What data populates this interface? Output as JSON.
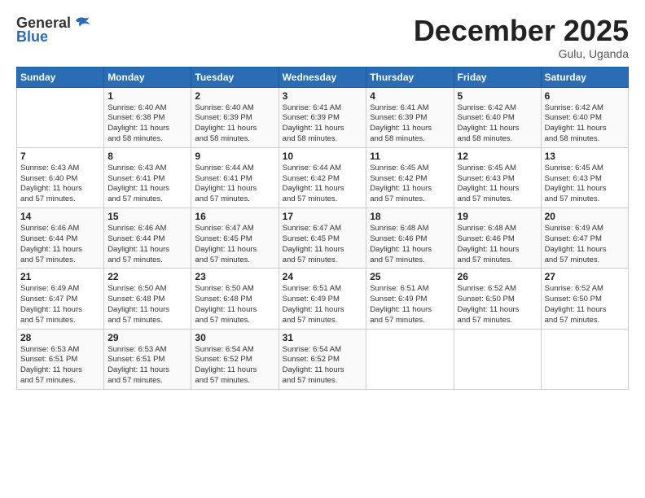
{
  "header": {
    "logo_general": "General",
    "logo_blue": "Blue",
    "title": "December 2025",
    "location": "Gulu, Uganda"
  },
  "days_of_week": [
    "Sunday",
    "Monday",
    "Tuesday",
    "Wednesday",
    "Thursday",
    "Friday",
    "Saturday"
  ],
  "weeks": [
    [
      {
        "day": "",
        "info": ""
      },
      {
        "day": "1",
        "info": "Sunrise: 6:40 AM\nSunset: 6:38 PM\nDaylight: 11 hours\nand 58 minutes."
      },
      {
        "day": "2",
        "info": "Sunrise: 6:40 AM\nSunset: 6:39 PM\nDaylight: 11 hours\nand 58 minutes."
      },
      {
        "day": "3",
        "info": "Sunrise: 6:41 AM\nSunset: 6:39 PM\nDaylight: 11 hours\nand 58 minutes."
      },
      {
        "day": "4",
        "info": "Sunrise: 6:41 AM\nSunset: 6:39 PM\nDaylight: 11 hours\nand 58 minutes."
      },
      {
        "day": "5",
        "info": "Sunrise: 6:42 AM\nSunset: 6:40 PM\nDaylight: 11 hours\nand 58 minutes."
      },
      {
        "day": "6",
        "info": "Sunrise: 6:42 AM\nSunset: 6:40 PM\nDaylight: 11 hours\nand 58 minutes."
      }
    ],
    [
      {
        "day": "7",
        "info": "Sunrise: 6:43 AM\nSunset: 6:40 PM\nDaylight: 11 hours\nand 57 minutes."
      },
      {
        "day": "8",
        "info": "Sunrise: 6:43 AM\nSunset: 6:41 PM\nDaylight: 11 hours\nand 57 minutes."
      },
      {
        "day": "9",
        "info": "Sunrise: 6:44 AM\nSunset: 6:41 PM\nDaylight: 11 hours\nand 57 minutes."
      },
      {
        "day": "10",
        "info": "Sunrise: 6:44 AM\nSunset: 6:42 PM\nDaylight: 11 hours\nand 57 minutes."
      },
      {
        "day": "11",
        "info": "Sunrise: 6:45 AM\nSunset: 6:42 PM\nDaylight: 11 hours\nand 57 minutes."
      },
      {
        "day": "12",
        "info": "Sunrise: 6:45 AM\nSunset: 6:43 PM\nDaylight: 11 hours\nand 57 minutes."
      },
      {
        "day": "13",
        "info": "Sunrise: 6:45 AM\nSunset: 6:43 PM\nDaylight: 11 hours\nand 57 minutes."
      }
    ],
    [
      {
        "day": "14",
        "info": "Sunrise: 6:46 AM\nSunset: 6:44 PM\nDaylight: 11 hours\nand 57 minutes."
      },
      {
        "day": "15",
        "info": "Sunrise: 6:46 AM\nSunset: 6:44 PM\nDaylight: 11 hours\nand 57 minutes."
      },
      {
        "day": "16",
        "info": "Sunrise: 6:47 AM\nSunset: 6:45 PM\nDaylight: 11 hours\nand 57 minutes."
      },
      {
        "day": "17",
        "info": "Sunrise: 6:47 AM\nSunset: 6:45 PM\nDaylight: 11 hours\nand 57 minutes."
      },
      {
        "day": "18",
        "info": "Sunrise: 6:48 AM\nSunset: 6:46 PM\nDaylight: 11 hours\nand 57 minutes."
      },
      {
        "day": "19",
        "info": "Sunrise: 6:48 AM\nSunset: 6:46 PM\nDaylight: 11 hours\nand 57 minutes."
      },
      {
        "day": "20",
        "info": "Sunrise: 6:49 AM\nSunset: 6:47 PM\nDaylight: 11 hours\nand 57 minutes."
      }
    ],
    [
      {
        "day": "21",
        "info": "Sunrise: 6:49 AM\nSunset: 6:47 PM\nDaylight: 11 hours\nand 57 minutes."
      },
      {
        "day": "22",
        "info": "Sunrise: 6:50 AM\nSunset: 6:48 PM\nDaylight: 11 hours\nand 57 minutes."
      },
      {
        "day": "23",
        "info": "Sunrise: 6:50 AM\nSunset: 6:48 PM\nDaylight: 11 hours\nand 57 minutes."
      },
      {
        "day": "24",
        "info": "Sunrise: 6:51 AM\nSunset: 6:49 PM\nDaylight: 11 hours\nand 57 minutes."
      },
      {
        "day": "25",
        "info": "Sunrise: 6:51 AM\nSunset: 6:49 PM\nDaylight: 11 hours\nand 57 minutes."
      },
      {
        "day": "26",
        "info": "Sunrise: 6:52 AM\nSunset: 6:50 PM\nDaylight: 11 hours\nand 57 minutes."
      },
      {
        "day": "27",
        "info": "Sunrise: 6:52 AM\nSunset: 6:50 PM\nDaylight: 11 hours\nand 57 minutes."
      }
    ],
    [
      {
        "day": "28",
        "info": "Sunrise: 6:53 AM\nSunset: 6:51 PM\nDaylight: 11 hours\nand 57 minutes."
      },
      {
        "day": "29",
        "info": "Sunrise: 6:53 AM\nSunset: 6:51 PM\nDaylight: 11 hours\nand 57 minutes."
      },
      {
        "day": "30",
        "info": "Sunrise: 6:54 AM\nSunset: 6:52 PM\nDaylight: 11 hours\nand 57 minutes."
      },
      {
        "day": "31",
        "info": "Sunrise: 6:54 AM\nSunset: 6:52 PM\nDaylight: 11 hours\nand 57 minutes."
      },
      {
        "day": "",
        "info": ""
      },
      {
        "day": "",
        "info": ""
      },
      {
        "day": "",
        "info": ""
      }
    ]
  ]
}
